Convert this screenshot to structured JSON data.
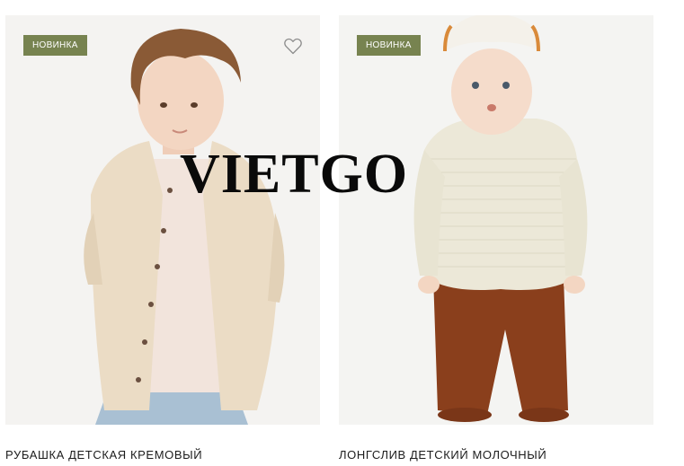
{
  "products": [
    {
      "badge": "НОВИНКА",
      "title": "РУБАШКА ДЕТСКАЯ КРЕМОВЫЙ",
      "image": "boy-in-cream-shirt",
      "has_favorite": true,
      "favorite_icon": "heart-outline-icon"
    },
    {
      "badge": "НОВИНКА",
      "title": "ЛОНГСЛИВ ДЕТСКИЙ МОЛОЧНЫЙ",
      "image": "toddler-in-striped-longsleeve",
      "has_favorite": false
    }
  ],
  "watermark": "VIETGO",
  "colors": {
    "badge_bg": "#778350",
    "photo_bg": "#f3f3f1",
    "text": "#1c1c1c"
  }
}
